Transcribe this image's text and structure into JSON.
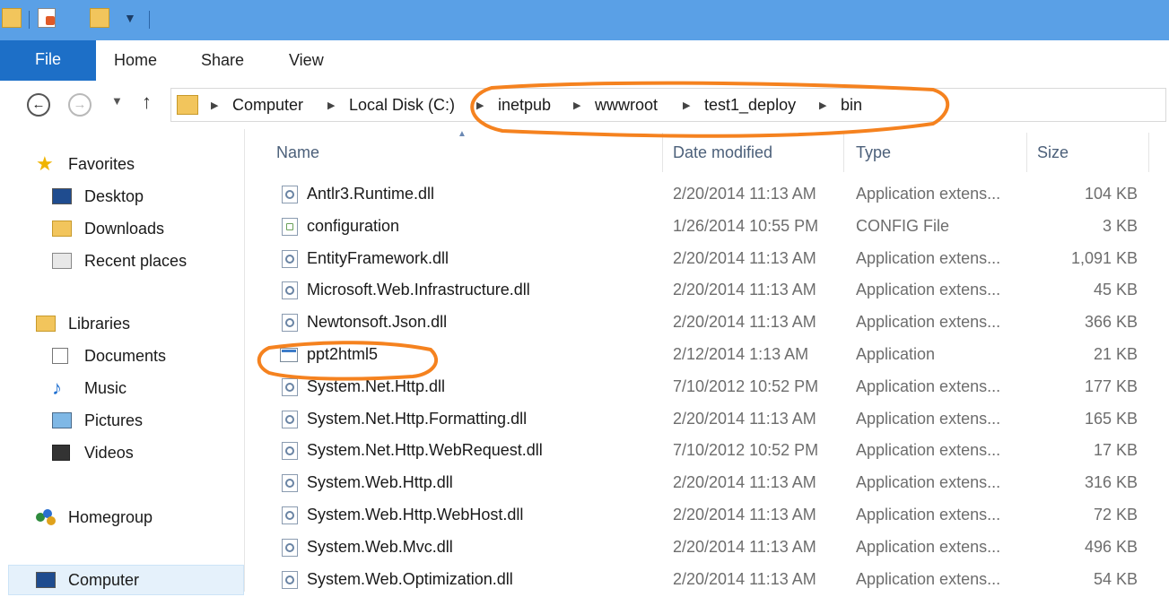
{
  "ribbon": {
    "tabs": [
      "File",
      "Home",
      "Share",
      "View"
    ]
  },
  "address": {
    "crumbs": [
      "Computer",
      "Local Disk (C:)",
      "inetpub",
      "wwwroot",
      "test1_deploy",
      "bin"
    ]
  },
  "nav": {
    "favorites": {
      "label": "Favorites",
      "items": [
        "Desktop",
        "Downloads",
        "Recent places"
      ]
    },
    "libraries": {
      "label": "Libraries",
      "items": [
        "Documents",
        "Music",
        "Pictures",
        "Videos"
      ]
    },
    "homegroup": "Homegroup",
    "computer": "Computer"
  },
  "columns": [
    "Name",
    "Date modified",
    "Type",
    "Size"
  ],
  "files": [
    {
      "name": "Antlr3.Runtime.dll",
      "date": "2/20/2014 11:13 AM",
      "type": "Application extens...",
      "size": "104 KB",
      "icon": "dll-icon"
    },
    {
      "name": "configuration",
      "date": "1/26/2014 10:55 PM",
      "type": "CONFIG File",
      "size": "3 KB",
      "icon": "config-file-icon"
    },
    {
      "name": "EntityFramework.dll",
      "date": "2/20/2014 11:13 AM",
      "type": "Application extens...",
      "size": "1,091 KB",
      "icon": "dll-icon"
    },
    {
      "name": "Microsoft.Web.Infrastructure.dll",
      "date": "2/20/2014 11:13 AM",
      "type": "Application extens...",
      "size": "45 KB",
      "icon": "dll-icon"
    },
    {
      "name": "Newtonsoft.Json.dll",
      "date": "2/20/2014 11:13 AM",
      "type": "Application extens...",
      "size": "366 KB",
      "icon": "dll-icon"
    },
    {
      "name": "ppt2html5",
      "date": "2/12/2014 1:13 AM",
      "type": "Application",
      "size": "21 KB",
      "icon": "application-icon"
    },
    {
      "name": "System.Net.Http.dll",
      "date": "7/10/2012 10:52 PM",
      "type": "Application extens...",
      "size": "177 KB",
      "icon": "dll-icon"
    },
    {
      "name": "System.Net.Http.Formatting.dll",
      "date": "2/20/2014 11:13 AM",
      "type": "Application extens...",
      "size": "165 KB",
      "icon": "dll-icon"
    },
    {
      "name": "System.Net.Http.WebRequest.dll",
      "date": "7/10/2012 10:52 PM",
      "type": "Application extens...",
      "size": "17 KB",
      "icon": "dll-icon"
    },
    {
      "name": "System.Web.Http.dll",
      "date": "2/20/2014 11:13 AM",
      "type": "Application extens...",
      "size": "316 KB",
      "icon": "dll-icon"
    },
    {
      "name": "System.Web.Http.WebHost.dll",
      "date": "2/20/2014 11:13 AM",
      "type": "Application extens...",
      "size": "72 KB",
      "icon": "dll-icon"
    },
    {
      "name": "System.Web.Mvc.dll",
      "date": "2/20/2014 11:13 AM",
      "type": "Application extens...",
      "size": "496 KB",
      "icon": "dll-icon"
    },
    {
      "name": "System.Web.Optimization.dll",
      "date": "2/20/2014 11:13 AM",
      "type": "Application extens...",
      "size": "54 KB",
      "icon": "dll-icon"
    }
  ],
  "colors": {
    "accent": "#1d6fc7",
    "titlebar": "#5aa0e6",
    "annotation": "#f5821f"
  }
}
